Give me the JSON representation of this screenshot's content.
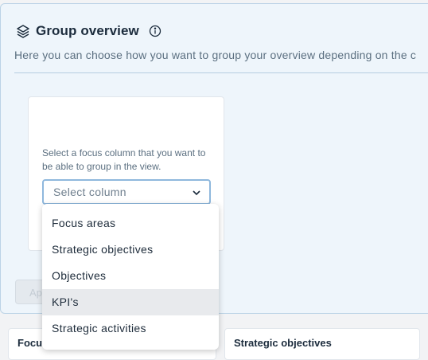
{
  "header": {
    "title": "Group overview",
    "subtitle": "Here you can choose how you want to group your overview depending on the c"
  },
  "card": {
    "instruction": "Select a focus column that you want to be able to group in the view.",
    "select_placeholder": "Select column"
  },
  "apply_button_label": "Ap",
  "dropdown": {
    "options": [
      "Focus areas",
      "Strategic objectives",
      "Objectives",
      "KPI's",
      "Strategic activities"
    ],
    "highlighted": "KPI's"
  },
  "bottom_cards": {
    "focus_label": "Focu",
    "strategic_label": "Strategic objectives"
  }
}
